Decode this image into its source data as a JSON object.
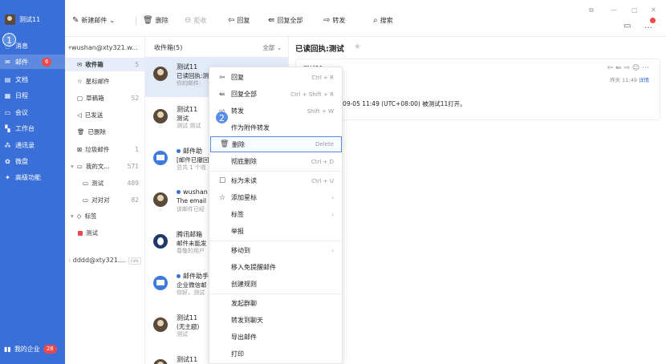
{
  "user": {
    "name": "测试11"
  },
  "nav": {
    "items": [
      {
        "key": "messages",
        "label": "消息",
        "icon": "chat-icon"
      },
      {
        "key": "mail",
        "label": "邮件",
        "icon": "mail-icon",
        "badge": "6"
      },
      {
        "key": "docs",
        "label": "文档",
        "icon": "doc-icon"
      },
      {
        "key": "calendar",
        "label": "日程",
        "icon": "calendar-icon"
      },
      {
        "key": "meeting",
        "label": "会议",
        "icon": "meeting-icon"
      },
      {
        "key": "workbench",
        "label": "工作台",
        "icon": "grid-icon"
      },
      {
        "key": "contacts",
        "label": "通讯录",
        "icon": "contacts-icon"
      },
      {
        "key": "drive",
        "label": "微盘",
        "icon": "drive-icon"
      },
      {
        "key": "advanced",
        "label": "高级功能",
        "icon": "magic-icon"
      }
    ],
    "bottom": {
      "label": "我的企业",
      "badge": "28"
    }
  },
  "steps": {
    "one": "1",
    "two": "2"
  },
  "toolbar": {
    "new_mail": "新建邮件",
    "delete": "删除",
    "reject": "拒收",
    "reply": "回复",
    "reply_all": "回复全部",
    "forward": "转发",
    "search": "搜索"
  },
  "folders": {
    "account1": "wushan@xty321.w...",
    "items": [
      {
        "label": "收件箱",
        "count": "5",
        "icon": "inbox-icon"
      },
      {
        "label": "星标邮件",
        "count": "",
        "icon": "star-icon"
      },
      {
        "label": "草稿箱",
        "count": "52",
        "icon": "draft-icon"
      },
      {
        "label": "已发送",
        "count": "",
        "icon": "send-icon"
      },
      {
        "label": "已删除",
        "count": "",
        "icon": "trash-icon"
      },
      {
        "label": "垃圾邮件",
        "count": "1",
        "icon": "spam-icon"
      },
      {
        "label": "我的文...",
        "count": "571",
        "icon": "folder-icon"
      },
      {
        "label": "测试",
        "count": "489",
        "icon": "folder-icon"
      },
      {
        "label": "对对对",
        "count": "82",
        "icon": "folder-icon"
      },
      {
        "label": "标签",
        "count": "",
        "icon": "tag-icon"
      },
      {
        "label": "测试",
        "count": "",
        "icon": "tag-red-icon"
      }
    ],
    "account2": "dddd@xty321....",
    "account2_tag": "ces"
  },
  "list": {
    "header": "收件箱(5)",
    "filter": "全部",
    "rows": [
      {
        "from": "测试11",
        "subject": "已读回执:测",
        "preview": "你的邮件:",
        "avatar": "photo"
      },
      {
        "from": "测试11",
        "subject": "测试",
        "preview": "测试 测试",
        "avatar": "photo"
      },
      {
        "from": "邮件助",
        "subject": "[邮件已撤回]",
        "preview": "总共 1 个收",
        "avatar": "blue",
        "unread": true
      },
      {
        "from": "wushan",
        "subject": "The email",
        "preview": "该邮件已经",
        "avatar": "photo",
        "unread": true
      },
      {
        "from": "腾讯邮箱",
        "subject": "邮件未能发",
        "preview": "尊敬的用户",
        "avatar": "qq"
      },
      {
        "from": "邮件助手",
        "subject": "企业微信邮",
        "preview": "你好，测试",
        "avatar": "blue",
        "unread": true
      },
      {
        "from": "测试11",
        "subject": "(无主题)",
        "preview": "测试",
        "avatar": "photo"
      },
      {
        "from": "测试11",
        "subject": "",
        "preview": "",
        "avatar": "photo"
      }
    ]
  },
  "reading": {
    "title": "已读回执:测试",
    "from": "测试11",
    "time": "昨天 11:49",
    "detail": "详情",
    "body": "试 已于 2023-09-05 11:49 (UTC+08:00) 被测试11打开。"
  },
  "context_menu": [
    {
      "label": "回复",
      "shortcut": "Ctrl + R",
      "icon": "reply-icon"
    },
    {
      "label": "回复全部",
      "shortcut": "Ctrl + Shift + R",
      "icon": "reply-all-icon"
    },
    {
      "label": "转发",
      "shortcut": "Shift + W",
      "icon": "forward-icon"
    },
    {
      "label": "作为附件转发",
      "shortcut": "",
      "icon": ""
    },
    {
      "label": "删除",
      "shortcut": "Delete",
      "icon": "trash-icon",
      "highlight": true
    },
    {
      "label": "彻底删除",
      "shortcut": "Ctrl + D",
      "icon": ""
    },
    {
      "label": "标为未读",
      "shortcut": "Ctrl + U",
      "icon": "unread-icon"
    },
    {
      "label": "添加星标",
      "shortcut": "›",
      "icon": "star-icon"
    },
    {
      "label": "标签",
      "shortcut": "›",
      "icon": ""
    },
    {
      "label": "举报",
      "shortcut": "",
      "icon": ""
    },
    {
      "label": "移动到",
      "shortcut": "›",
      "icon": ""
    },
    {
      "label": "移入免提醒邮件",
      "shortcut": "",
      "icon": ""
    },
    {
      "label": "创建规则",
      "shortcut": "",
      "icon": ""
    },
    {
      "label": "发起群聊",
      "shortcut": "",
      "icon": ""
    },
    {
      "label": "转发到聊天",
      "shortcut": "",
      "icon": ""
    },
    {
      "label": "导出邮件",
      "shortcut": "",
      "icon": ""
    },
    {
      "label": "打印",
      "shortcut": "",
      "icon": ""
    }
  ]
}
